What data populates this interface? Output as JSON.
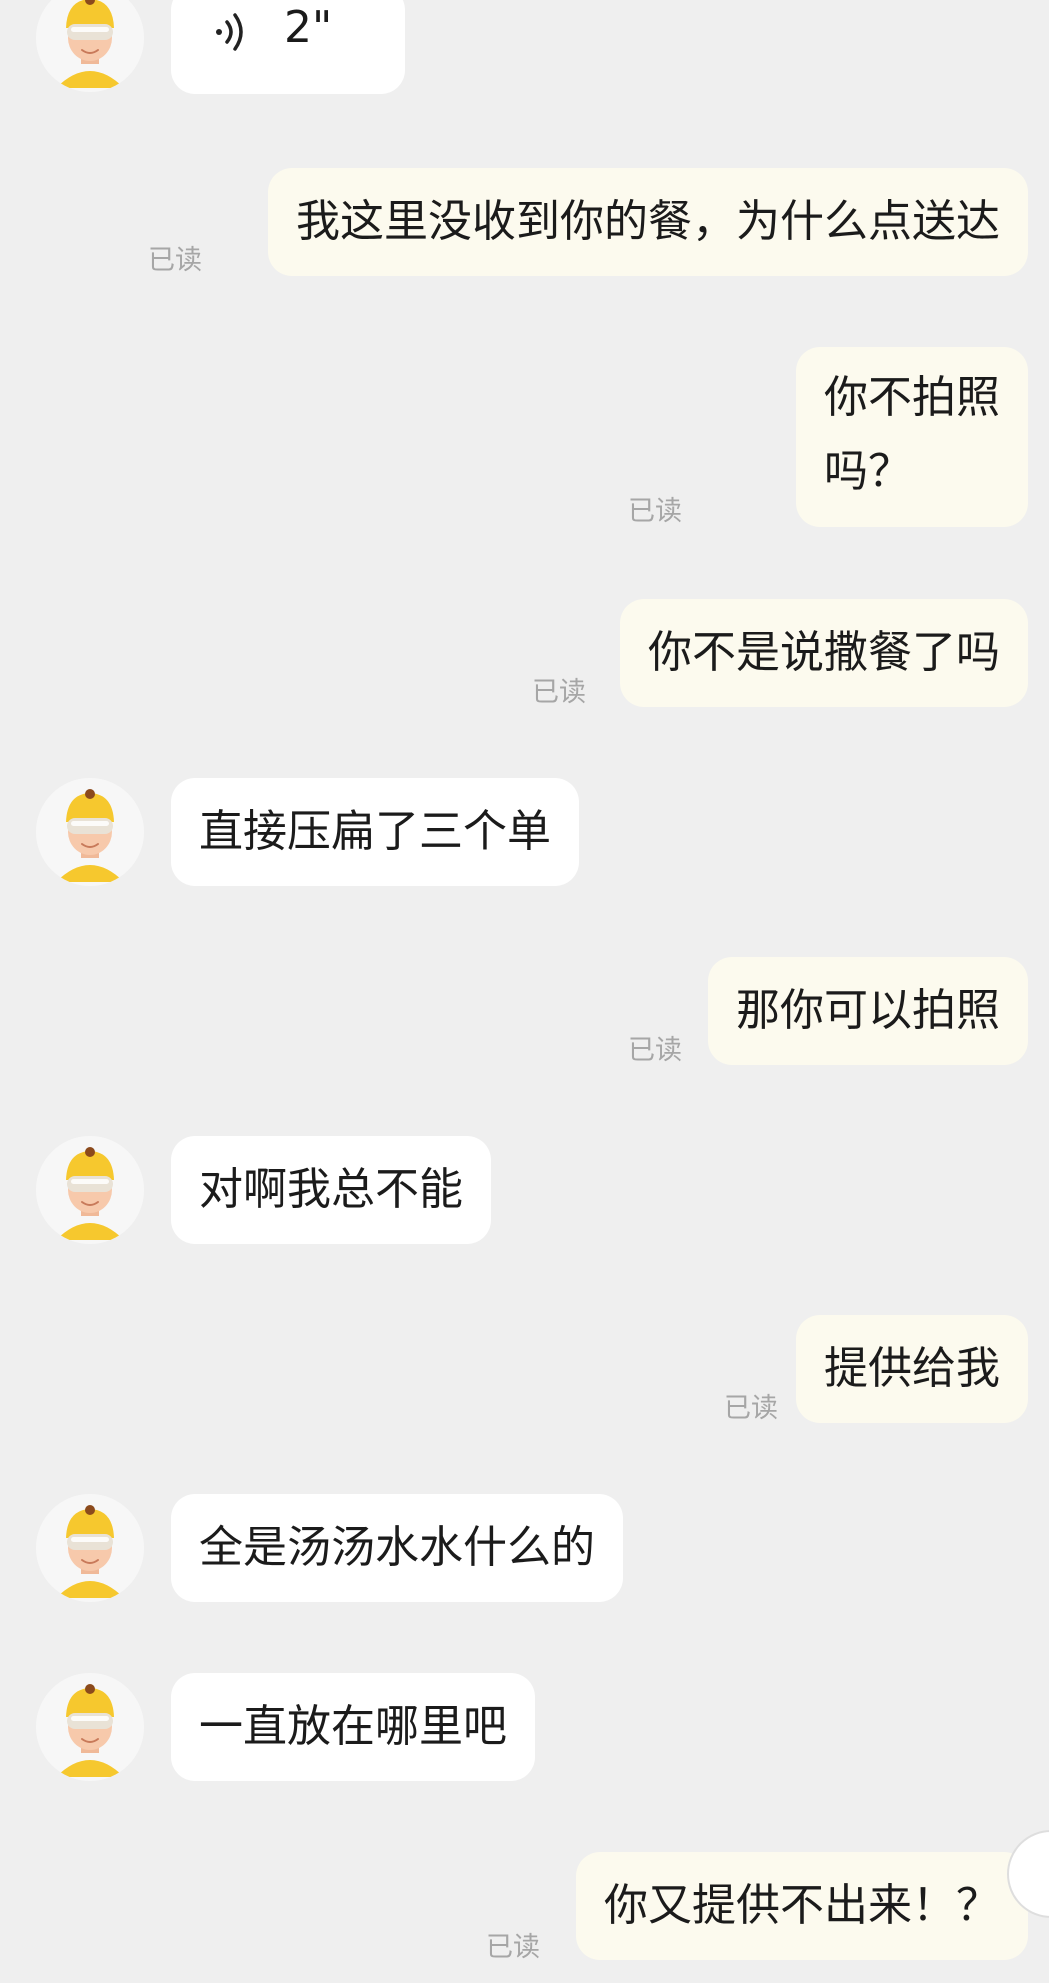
{
  "read_label": "已读",
  "colors": {
    "background": "#efefef",
    "incoming_bubble": "#ffffff",
    "outgoing_bubble": "#fcfaee",
    "read_text": "#a6a6a6",
    "helmet": "#f6c82e"
  },
  "messages": [
    {
      "side": "in",
      "type": "voice",
      "duration": "2\""
    },
    {
      "side": "out",
      "text": "我这里没收到你的餐，为什么点送达",
      "read": "已读"
    },
    {
      "side": "out",
      "lines": [
        "你不拍照",
        "吗？"
      ],
      "read": "已读"
    },
    {
      "side": "out",
      "text": "你不是说撒餐了吗",
      "read": "已读"
    },
    {
      "side": "in",
      "text": "直接压扁了三个单"
    },
    {
      "side": "out",
      "text": "那你可以拍照",
      "read": "已读"
    },
    {
      "side": "in",
      "text": "对啊我总不能"
    },
    {
      "side": "out",
      "text": "提供给我",
      "read": "已读"
    },
    {
      "side": "in",
      "text": "全是汤汤水水什么的"
    },
    {
      "side": "in",
      "text": "一直放在哪里吧"
    },
    {
      "side": "out",
      "text": "你又提供不出来！？",
      "read": "已读"
    }
  ],
  "icons": {
    "avatar": "courier-avatar-icon",
    "voice": "voice-wave-icon"
  }
}
